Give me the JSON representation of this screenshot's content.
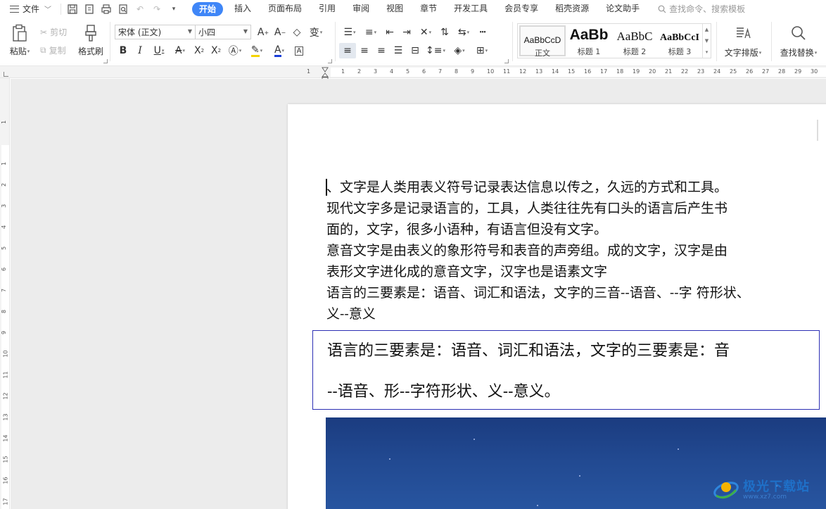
{
  "menubar": {
    "file_label": "文件",
    "tabs": [
      {
        "label": "开始",
        "active": true
      },
      {
        "label": "插入"
      },
      {
        "label": "页面布局"
      },
      {
        "label": "引用"
      },
      {
        "label": "审阅"
      },
      {
        "label": "视图"
      },
      {
        "label": "章节"
      },
      {
        "label": "开发工具"
      },
      {
        "label": "会员专享"
      },
      {
        "label": "稻壳资源"
      },
      {
        "label": "论文助手"
      }
    ],
    "search_placeholder": "查找命令、搜索模板",
    "accent_color": "#3f86f7"
  },
  "ribbon": {
    "paste_label": "粘贴",
    "cut_label": "剪切",
    "copy_label": "复制",
    "format_painter_label": "格式刷",
    "font_name": "宋体 (正文)",
    "font_size": "小四",
    "styles": [
      {
        "preview": "AaBbCcD",
        "name": "正文"
      },
      {
        "preview": "AaBb",
        "name": "标题 1"
      },
      {
        "preview": "AaBbC",
        "name": "标题 2"
      },
      {
        "preview": "AaBbCcI",
        "name": "标题 3"
      }
    ],
    "text_layout_label": "文字排版",
    "find_replace_label": "查找替换"
  },
  "ruler": {
    "horizontal_ticks": [
      "1",
      "1",
      "2",
      "3",
      "4",
      "5",
      "6",
      "7",
      "8",
      "9",
      "10",
      "11",
      "12",
      "13",
      "14",
      "15",
      "16",
      "17",
      "18",
      "19",
      "20",
      "21",
      "22",
      "23",
      "24",
      "25",
      "26",
      "27",
      "28",
      "29",
      "30"
    ],
    "vertical_ticks": [
      "1",
      "1",
      "2",
      "3",
      "4",
      "5",
      "6",
      "7",
      "8",
      "9",
      "10",
      "11",
      "12",
      "13",
      "14",
      "15",
      "16",
      "17"
    ]
  },
  "document": {
    "lines": [
      "、文字是人类用表义符号记录表达信息以传之，久远的方式和工具。",
      "现代文字多是记录语言的，工具，人类往往先有口头的语言后产生书",
      "面的，文字，很多小语种，有语言但没有文字。",
      "意音文字是由表义的象形符号和表音的声旁组。成的文字，汉字是由",
      "表形文字进化成的意音文字，汉字也是语素文字",
      "语言的三要素是：语音、词汇和语法，文字的三音--语音、--字  符形状、",
      "义--意义"
    ],
    "boxed_lines": [
      "语言的三要素是：语音、词汇和语法，文字的三要素是：音",
      "--语音、形--字符形状、义--意义。"
    ]
  },
  "watermark": {
    "main": "极光下载站",
    "sub": "www.xz7.com"
  }
}
